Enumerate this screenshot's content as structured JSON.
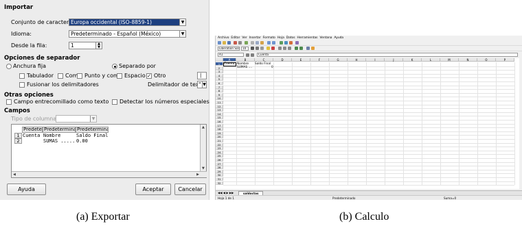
{
  "dialog": {
    "section_import": "Importar",
    "charset_label": "Conjunto de caracteres:",
    "charset_value": "Europa occidental (ISO-8859-1)",
    "language_label": "Idioma:",
    "language_value": "Predeterminado - Español (México)",
    "from_row_label": "Desde la fila:",
    "from_row_value": "1",
    "section_separator": "Opciones de separador",
    "fixed_width_label": "Anchura fija",
    "separated_by_label": "Separado por",
    "tab_label": "Tabulador",
    "comma_label": "Coma",
    "semicolon_label": "Punto y coma",
    "space_label": "Espacio",
    "other_label": "Otro",
    "other_value": "|",
    "merge_delimiters_label": "Fusionar los delimitadores",
    "text_delimiter_label": "Delimitador de texto:",
    "text_delimiter_value": "\"",
    "section_other": "Otras opciones",
    "quoted_as_text_label": "Campo entrecomillado como texto",
    "detect_special_label": "Detectar los números especiales",
    "section_fields": "Campos",
    "column_type_label": "Tipo de columna:",
    "column_type_value": "",
    "preview": {
      "headers": [
        "Predetem",
        "Predeterminad",
        "Predeterminad"
      ],
      "rows": [
        {
          "num": "1",
          "cells": [
            "Cuenta",
            "Nombre",
            "Saldo Final"
          ]
        },
        {
          "num": "2",
          "cells": [
            "",
            "SUMAS .....",
            "0.00"
          ]
        }
      ]
    },
    "help_button": "Ayuda",
    "accept_button": "Aceptar",
    "cancel_button": "Cancelar"
  },
  "calc": {
    "menu": [
      "Archivo",
      "Editar",
      "Ver",
      "Insertar",
      "Formato",
      "Hoja",
      "Datos",
      "Herramientas",
      "Ventana",
      "Ayuda"
    ],
    "font_name": "Liberation Sans",
    "font_size": "10",
    "name_box": "A1",
    "formula_value": "Cuenta",
    "columns": [
      "A",
      "B",
      "C",
      "D",
      "E",
      "F",
      "G",
      "H",
      "I",
      "J",
      "K",
      "L",
      "M",
      "N",
      "O",
      "P"
    ],
    "rows": [
      "1",
      "2",
      "3",
      "4",
      "5",
      "6",
      "7",
      "8",
      "9",
      "10",
      "11",
      "12",
      "13",
      "14",
      "15",
      "16",
      "17",
      "18",
      "19",
      "20",
      "21",
      "22",
      "23",
      "24",
      "25",
      "26",
      "27",
      "28",
      "29",
      "30",
      "31",
      "32"
    ],
    "cells": {
      "a1": "Cuenta",
      "b1": "Nombre",
      "c1": "Saldo Final",
      "b2": "SUMAS ....",
      "c2": "0"
    },
    "sheet_tab": "saldoctas",
    "status_sheet": "Hoja 1 de 1",
    "status_style": "Predeterminado",
    "status_sum": "Suma=0"
  },
  "captions": {
    "left": "(a)  Exportar",
    "right": "(b)  Calculo"
  }
}
